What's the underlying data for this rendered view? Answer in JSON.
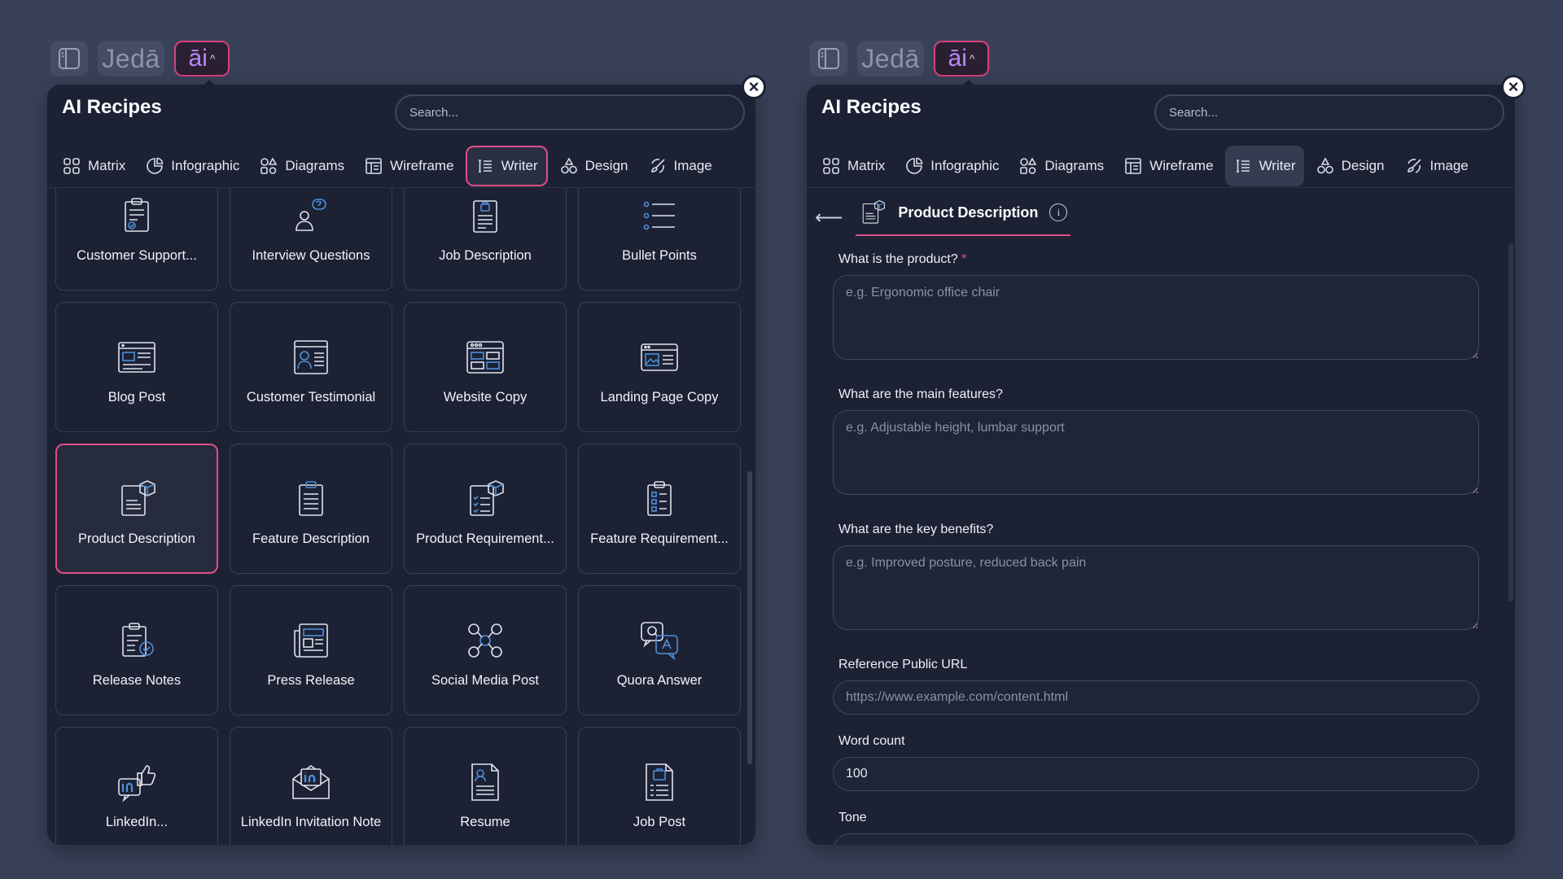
{
  "toolbar": {
    "logo": "Jedā",
    "ai_label": "āi",
    "chevron": "^"
  },
  "panel_title": "AI Recipes",
  "search_placeholder": "Search...",
  "tabs": [
    {
      "label": "Matrix",
      "icon": "grid-icon"
    },
    {
      "label": "Infographic",
      "icon": "pie-chart-icon"
    },
    {
      "label": "Diagrams",
      "icon": "shapes-icon"
    },
    {
      "label": "Wireframe",
      "icon": "wireframe-icon"
    },
    {
      "label": "Writer",
      "icon": "writer-icon"
    },
    {
      "label": "Design",
      "icon": "design-icon"
    },
    {
      "label": "Image",
      "icon": "brush-icon"
    }
  ],
  "recipes": [
    {
      "label": "Customer Support...",
      "icon": "clipboard-check-icon"
    },
    {
      "label": "Interview Questions",
      "icon": "interview-icon"
    },
    {
      "label": "Job Description",
      "icon": "job-doc-icon"
    },
    {
      "label": "Bullet Points",
      "icon": "list-icon"
    },
    {
      "label": "Blog Post",
      "icon": "blog-icon"
    },
    {
      "label": "Customer Testimonial",
      "icon": "testimonial-icon"
    },
    {
      "label": "Website Copy",
      "icon": "website-icon"
    },
    {
      "label": "Landing Page Copy",
      "icon": "landing-icon"
    },
    {
      "label": "Product Description",
      "icon": "product-box-icon"
    },
    {
      "label": "Feature Description",
      "icon": "feature-doc-icon"
    },
    {
      "label": "Product Requirement...",
      "icon": "product-req-icon"
    },
    {
      "label": "Feature Requirement...",
      "icon": "feature-req-icon"
    },
    {
      "label": "Release Notes",
      "icon": "release-notes-icon"
    },
    {
      "label": "Press Release",
      "icon": "newspaper-icon"
    },
    {
      "label": "Social Media Post",
      "icon": "social-icon"
    },
    {
      "label": "Quora Answer",
      "icon": "qa-icon"
    },
    {
      "label": "LinkedIn...",
      "icon": "linkedin-like-icon"
    },
    {
      "label": "LinkedIn Invitation Note",
      "icon": "linkedin-mail-icon"
    },
    {
      "label": "Resume",
      "icon": "resume-icon"
    },
    {
      "label": "Job Post",
      "icon": "job-post-icon"
    }
  ],
  "form": {
    "title": "Product Description",
    "product_label": "What is the product?",
    "required_mark": "*",
    "product_placeholder": "e.g. Ergonomic office chair",
    "features_label": "What are the main features?",
    "features_placeholder": "e.g. Adjustable height, lumbar support",
    "benefits_label": "What are the key benefits?",
    "benefits_placeholder": "e.g. Improved posture, reduced back pain",
    "url_label": "Reference Public URL",
    "url_placeholder": "https://www.example.com/content.html",
    "wordcount_label": "Word count",
    "wordcount_value": "100",
    "tone_label": "Tone"
  },
  "colors": {
    "accent": "#e04e86",
    "ai_purple": "#b888ff",
    "icon_blue": "#4f8ed8",
    "panel_bg": "#1c2234",
    "page_bg": "#394159"
  }
}
